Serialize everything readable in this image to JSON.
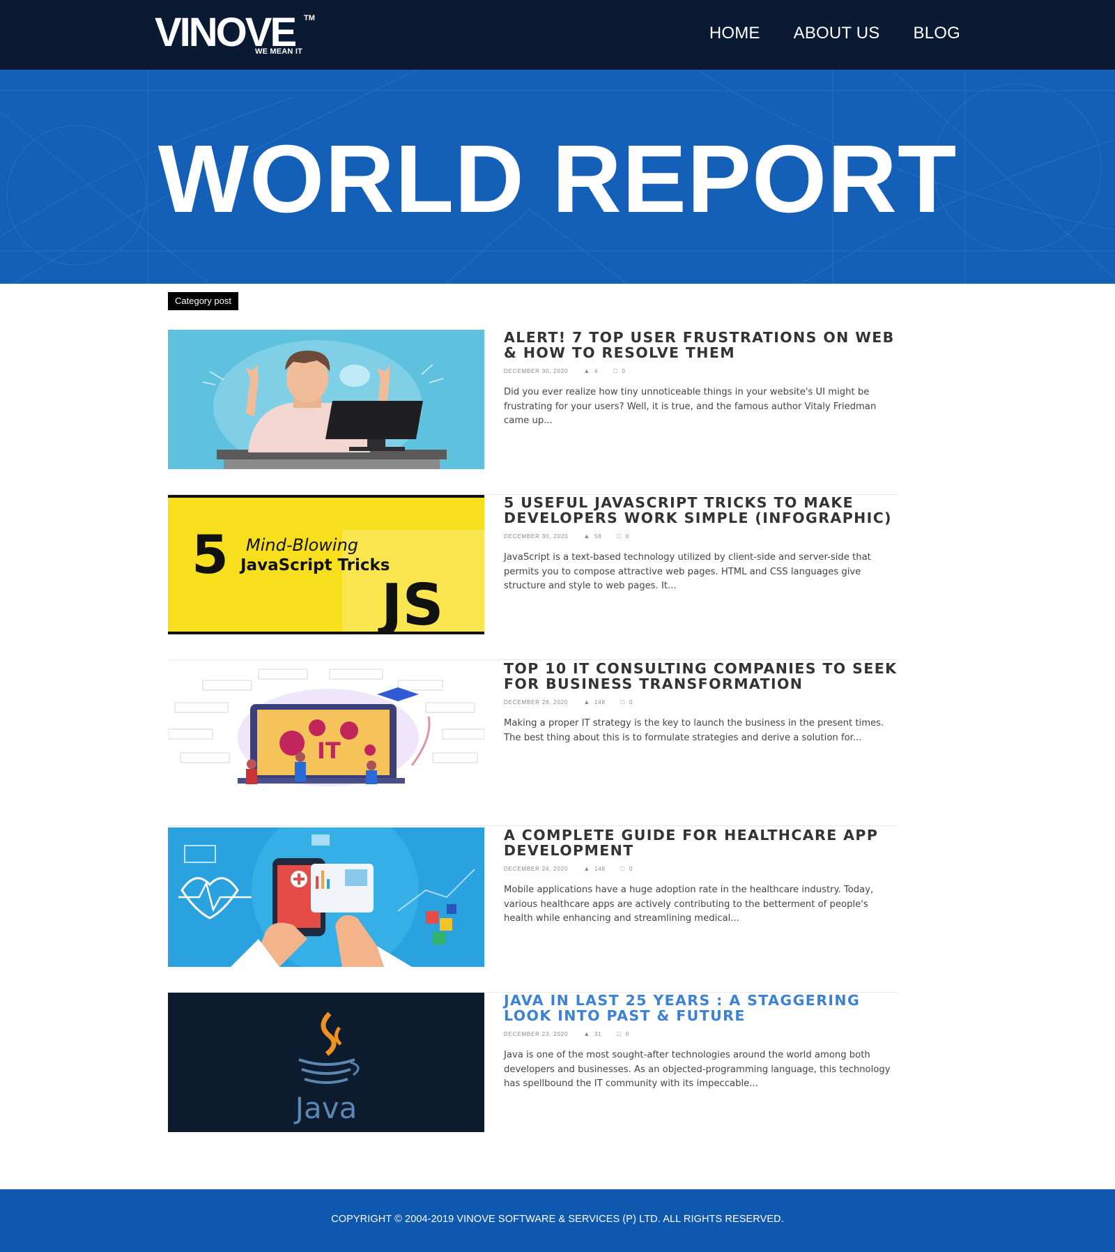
{
  "brand": {
    "name": "VINOVE",
    "tm": "TM",
    "tagline": "WE MEAN IT"
  },
  "nav": {
    "items": [
      {
        "label": "HOME"
      },
      {
        "label": "ABOUT US"
      },
      {
        "label": "BLOG"
      }
    ]
  },
  "hero": {
    "title": "WORLD REPORT"
  },
  "category_tag": "Category post",
  "posts": [
    {
      "title": "ALERT! 7 TOP USER FRUSTRATIONS ON WEB & HOW TO RESOLVE THEM",
      "date": "DECEMBER 30, 2020",
      "likes": "4",
      "comments": "0",
      "excerpt": "Did you ever realize how tiny unnoticeable things in your website's UI might be frustrating for your users? Well, it is true, and the famous author Vitaly Friedman came up...",
      "highlight": false,
      "image": "frustrated-user"
    },
    {
      "title": "5 USEFUL JAVASCRIPT TRICKS TO MAKE DEVELOPERS WORK SIMPLE (INFOGRAPHIC)",
      "date": "DECEMBER 30, 2020",
      "likes": "58",
      "comments": "0",
      "excerpt": "JavaScript is a text-based technology utilized by client-side and server-side that permits you to compose attractive web pages. HTML and CSS languages give structure and style to web pages. It...",
      "highlight": false,
      "image": "javascript-tricks",
      "image_text": {
        "num": "5",
        "line1": "Mind-Blowing",
        "line2": "JavaScript Tricks",
        "js": "JS"
      }
    },
    {
      "title": "TOP 10 IT CONSULTING COMPANIES TO SEEK FOR BUSINESS TRANSFORMATION",
      "date": "DECEMBER 28, 2020",
      "likes": "148",
      "comments": "0",
      "excerpt": "Making a proper IT strategy is the key to launch the business in the present times. The best thing about this is to formulate strategies and derive a solution for...",
      "highlight": false,
      "image": "it-consulting",
      "image_text": {
        "it": "IT"
      }
    },
    {
      "title": "A COMPLETE GUIDE FOR HEALTHCARE APP DEVELOPMENT",
      "date": "DECEMBER 24, 2020",
      "likes": "148",
      "comments": "0",
      "excerpt": "  Mobile applications have a huge adoption rate in the healthcare industry. Today, various healthcare apps are actively contributing to the betterment of people's health while enhancing and streamlining medical...",
      "highlight": false,
      "image": "healthcare-app"
    },
    {
      "title": "JAVA IN LAST 25 YEARS : A STAGGERING LOOK INTO PAST & FUTURE",
      "date": "DECEMBER 23, 2020",
      "likes": "31",
      "comments": "0",
      "excerpt": "Java is one of the most sought-after technologies around the world among both developers and businesses. As an objected-programming language, this technology has spellbound the IT community with its impeccable...",
      "highlight": true,
      "image": "java-logo",
      "image_text": {
        "java": "Java"
      }
    }
  ],
  "footer": {
    "copyright": "COPYRIGHT © 2004-2019 VINOVE SOFTWARE & SERVICES (P) LTD. ALL RIGHTS RESERVED."
  },
  "colors": {
    "header_bg": "#0a1a33",
    "hero_bg": "#1460b8",
    "footer_bg": "#0f58b0",
    "title_text": "#333333",
    "title_highlight": "#3b82d6"
  }
}
